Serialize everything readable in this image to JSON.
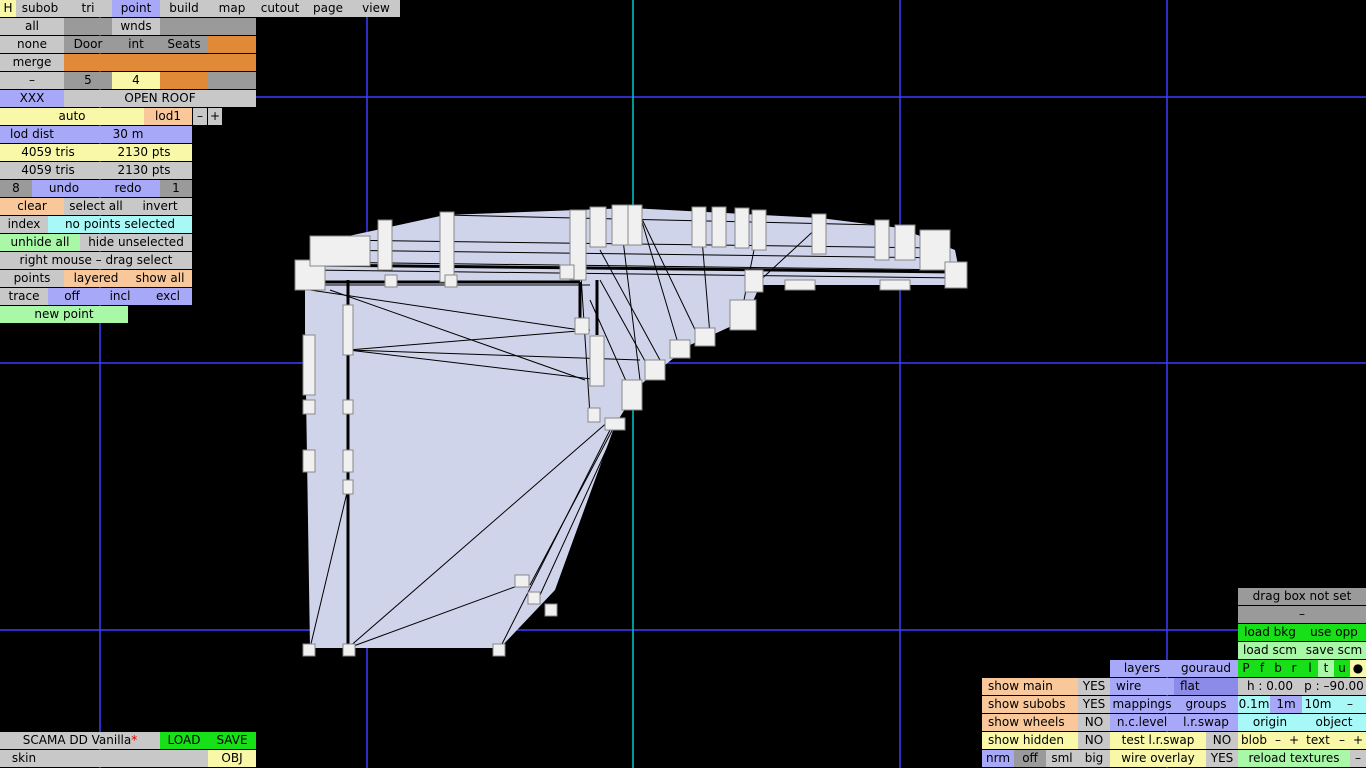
{
  "top_tabs": [
    "H",
    "subob",
    "tri",
    "point",
    "build",
    "map",
    "cutout",
    "page",
    "view"
  ],
  "row_all": [
    "all",
    "wnds"
  ],
  "row_none": [
    "none",
    "Door",
    "int",
    "Seats"
  ],
  "row_merge": [
    "merge"
  ],
  "row_dash": [
    "–",
    "5",
    "4"
  ],
  "row_xxx": [
    "XXX",
    "OPEN ROOF"
  ],
  "lod": {
    "auto": "auto",
    "lod": "lod1",
    "minus": "–",
    "plus": "+",
    "dist_label": "lod dist",
    "dist_value": "30 m"
  },
  "stats": {
    "tris1": "4059 tris",
    "pts1": "2130 pts",
    "tris2": "4059 tris",
    "pts2": "2130 pts"
  },
  "undo_row": {
    "count": "8",
    "undo": "undo",
    "redo": "redo",
    "redo_count": "1"
  },
  "select_row": {
    "clear": "clear",
    "select_all": "select all",
    "invert": "invert"
  },
  "index_row": {
    "index": "index",
    "status": "no points selected"
  },
  "hide_row": {
    "unhide_all": "unhide all",
    "hide_unselected": "hide unselected"
  },
  "drag_hint": "right mouse – drag select",
  "points_row": {
    "points": "points",
    "layered": "layered",
    "show_all": "show all"
  },
  "trace_row": {
    "trace": "trace",
    "off": "off",
    "incl": "incl",
    "excl": "excl"
  },
  "new_point": "new point",
  "file": {
    "name": "SCAMA DD Vanilla",
    "modified": "*",
    "load": "LOAD",
    "save": "SAVE",
    "skin": "skin",
    "obj": "OBJ"
  },
  "right_panel": {
    "drag_box": "drag box not set",
    "dash": "–",
    "load_bkg": "load bkg",
    "use_opp": "use opp",
    "load_scm": "load scm",
    "save_scm": "save scm",
    "views": [
      "P",
      "f",
      "b",
      "r",
      "l",
      "t",
      "u",
      "●"
    ],
    "h": "h : 0.00",
    "p": "p : –90.00",
    "steps": [
      "0.1m",
      "1m",
      "10m",
      "–"
    ],
    "origin": "origin",
    "object": "object",
    "blob": "blob",
    "text": "text",
    "minus": "–",
    "plus": "+",
    "reload": "reload textures"
  },
  "display_panel": {
    "show_main": "show main",
    "show_main_val": "YES",
    "show_subobs": "show subobs",
    "show_subobs_val": "YES",
    "show_wheels": "show wheels",
    "show_wheels_val": "NO",
    "show_hidden": "show hidden",
    "show_hidden_val": "NO",
    "layers": "layers",
    "gouraud": "gouraud",
    "wire": "wire",
    "flat": "flat",
    "mappings": "mappings",
    "groups": "groups",
    "nc_level": "n.c.level",
    "lr_swap": "l.r.swap",
    "test_lr_swap": "test l.r.swap",
    "test_lr_swap_val": "NO",
    "wire_overlay": "wire overlay",
    "wire_overlay_val": "YES",
    "sizes": [
      "nrm",
      "off",
      "sml",
      "big"
    ]
  },
  "colors": {
    "grid": "#3c3cff",
    "axis": "#00c8c8",
    "mesh": "#d0d4ea",
    "wire": "#000000"
  }
}
